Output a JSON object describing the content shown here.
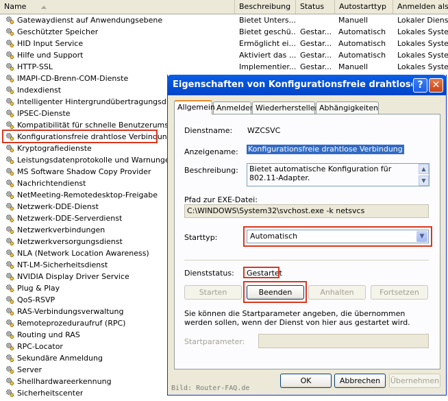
{
  "columns": {
    "name": "Name",
    "description": "Beschreibung",
    "status": "Status",
    "startup": "Autostarttyp",
    "logon": "Anmelden als"
  },
  "services": [
    {
      "name": "Gatewaydienst auf Anwendungsebene",
      "description": "Bietet Unters...",
      "status": "",
      "startup": "Manuell",
      "logon": "Lokaler Dienst"
    },
    {
      "name": "Geschützter Speicher",
      "description": "Bietet geschü...",
      "status": "Gestar...",
      "startup": "Automatisch",
      "logon": "Lokales System"
    },
    {
      "name": "HID Input Service",
      "description": "Ermöglicht ei...",
      "status": "Gestar...",
      "startup": "Automatisch",
      "logon": "Lokales System"
    },
    {
      "name": "Hilfe und Support",
      "description": "Aktiviert das ...",
      "status": "Gestar...",
      "startup": "Automatisch",
      "logon": "Lokales System"
    },
    {
      "name": "HTTP-SSL",
      "description": "Implementier...",
      "status": "Gestar...",
      "startup": "Manuell",
      "logon": "Lokales System"
    },
    {
      "name": "IMAPI-CD-Brenn-COM-Dienste"
    },
    {
      "name": "Indexdienst"
    },
    {
      "name": "Intelligenter Hintergrundübertragungsdienst"
    },
    {
      "name": "IPSEC-Dienste"
    },
    {
      "name": "Kompatibilität für schnelle Benutzerumschaltung"
    },
    {
      "name": "Konfigurationsfreie drahtlose Verbindung"
    },
    {
      "name": "Kryptografiedienste"
    },
    {
      "name": "Leistungsdatenprotokolle und Warnungen"
    },
    {
      "name": "MS Software Shadow Copy Provider"
    },
    {
      "name": "Nachrichtendienst"
    },
    {
      "name": "NetMeeting-Remotedesktop-Freigabe"
    },
    {
      "name": "Netzwerk-DDE-Dienst"
    },
    {
      "name": "Netzwerk-DDE-Serverdienst"
    },
    {
      "name": "Netzwerkverbindungen"
    },
    {
      "name": "Netzwerkversorgungsdienst"
    },
    {
      "name": "NLA (Network Location Awareness)"
    },
    {
      "name": "NT-LM-Sicherheitsdienst"
    },
    {
      "name": "NVIDIA Display Driver Service"
    },
    {
      "name": "Plug & Play"
    },
    {
      "name": "QoS-RSVP"
    },
    {
      "name": "RAS-Verbindungsverwaltung"
    },
    {
      "name": "Remoteprozeduraufruf (RPC)"
    },
    {
      "name": "Routing und RAS"
    },
    {
      "name": "RPC-Locator"
    },
    {
      "name": "Sekundäre Anmeldung"
    },
    {
      "name": "Server"
    },
    {
      "name": "Shellhardwareerkennung"
    },
    {
      "name": "Sicherheitscenter"
    }
  ],
  "dialog": {
    "title": "Eigenschaften von Konfigurationsfreie drahtlose Verbi...",
    "tabs": [
      "Allgemein",
      "Anmelden",
      "Wiederherstellen",
      "Abhängigkeiten"
    ],
    "service_name_label": "Dienstname:",
    "service_name": "WZCSVC",
    "display_name_label": "Anzeigename:",
    "display_name": "Konfigurationsfreie drahtlose Verbindung",
    "description_label": "Beschreibung:",
    "description": "Bietet automatische Konfiguration für 802.11-Adapter.",
    "path_label": "Pfad zur EXE-Datei:",
    "path": "C:\\WINDOWS\\System32\\svchost.exe -k netsvcs",
    "startup_label": "Starttyp:",
    "startup_value": "Automatisch",
    "status_label": "Dienststatus:",
    "status_value": "Gestartet",
    "buttons": {
      "start": "Starten",
      "stop": "Beenden",
      "pause": "Anhalten",
      "resume": "Fortsetzen"
    },
    "note": "Sie können die Startparameter angeben, die übernommen werden sollen, wenn der Dienst von hier aus gestartet wird.",
    "param_label": "Startparameter:",
    "ok": "OK",
    "cancel": "Abbrechen",
    "apply": "Übernehmen"
  },
  "watermark": "Bild: Router-FAQ.de",
  "colors": {
    "highlight": "#d9361f",
    "titlebar": "#0453d9",
    "selection": "#316ac5"
  }
}
